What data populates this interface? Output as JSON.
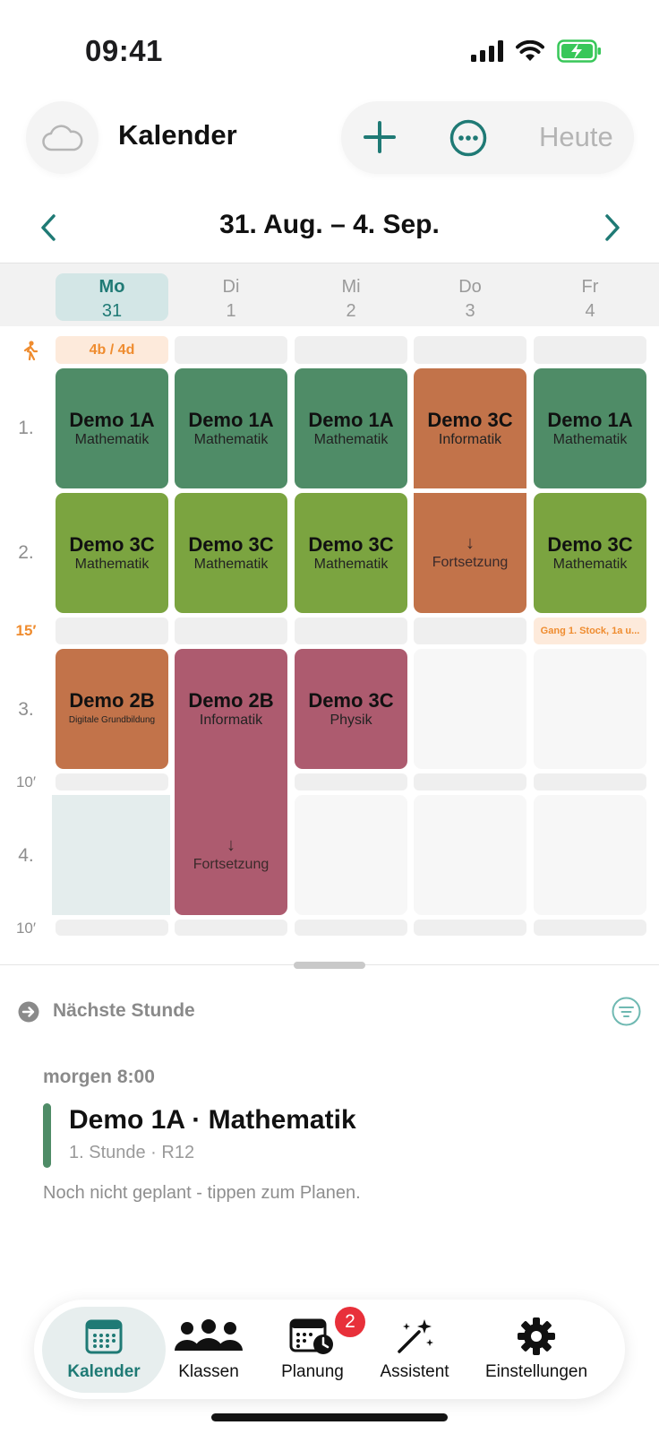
{
  "status": {
    "time": "09:41"
  },
  "header": {
    "title": "Kalender",
    "today_label": "Heute"
  },
  "week": {
    "title": "31. Aug. – 4. Sep."
  },
  "days": [
    {
      "name": "Mo",
      "date": "31",
      "active": true
    },
    {
      "name": "Di",
      "date": "1",
      "active": false
    },
    {
      "name": "Mi",
      "date": "2",
      "active": false
    },
    {
      "name": "Do",
      "date": "3",
      "active": false
    },
    {
      "name": "Fr",
      "date": "4",
      "active": false
    }
  ],
  "supervision": {
    "mo": "4b / 4d",
    "fr": "Gang 1. Stock, 1a u..."
  },
  "periods": {
    "p1": "1.",
    "p2": "2.",
    "p3": "3.",
    "p4": "4."
  },
  "breaks": {
    "b1": "15′",
    "b2": "10′",
    "b3": "10′"
  },
  "lessons": {
    "p1": [
      {
        "cls": "Demo 1A",
        "subj": "Mathematik"
      },
      {
        "cls": "Demo 1A",
        "subj": "Mathematik"
      },
      {
        "cls": "Demo 1A",
        "subj": "Mathematik"
      },
      {
        "cls": "Demo 3C",
        "subj": "Informatik"
      },
      {
        "cls": "Demo 1A",
        "subj": "Mathematik"
      }
    ],
    "p2": [
      {
        "cls": "Demo 3C",
        "subj": "Mathematik"
      },
      {
        "cls": "Demo 3C",
        "subj": "Mathematik"
      },
      {
        "cls": "Demo 3C",
        "subj": "Mathematik"
      },
      {
        "cls": "",
        "subj": ""
      },
      {
        "cls": "Demo 3C",
        "subj": "Mathematik"
      }
    ],
    "p3": [
      {
        "cls": "Demo 2B",
        "subj": "Digitale Grundbildung"
      },
      {
        "cls": "Demo 2B",
        "subj": "Informatik"
      },
      {
        "cls": "Demo 3C",
        "subj": "Physik"
      }
    ],
    "continuation": {
      "arrow": "↓",
      "label": "Fortsetzung"
    }
  },
  "next_lesson": {
    "section_title": "Nächste Stunde",
    "when": "morgen 8:00",
    "title": "Demo 1A · Mathematik",
    "meta": "1. Stunde · R12",
    "hint": "Noch nicht geplant - tippen zum Planen."
  },
  "tabs": {
    "calendar": "Kalender",
    "classes": "Klassen",
    "planning": "Planung",
    "assistant": "Assistent",
    "settings": "Einstellungen",
    "planning_badge": "2"
  },
  "colors": {
    "accent": "#1f7a75",
    "green": "#4f8c67",
    "lime": "#7ba440",
    "orange": "#c2734a",
    "rose": "#ad5b6f",
    "supervision": "#ef8c2f",
    "badge": "#e8303a"
  },
  "icons": {
    "cloud": "cloud-icon",
    "plus": "plus-icon",
    "more": "ellipsis-circle-icon",
    "prev": "chevron-left-icon",
    "next": "chevron-right-icon",
    "walker": "walking-person-icon",
    "next_lesson": "arrow-right-circle-icon",
    "filter": "filter-circle-icon",
    "calendar": "calendar-icon",
    "classes": "people-icon",
    "planning": "calendar-clock-icon",
    "assistant": "magic-wand-icon",
    "settings": "gear-icon"
  }
}
